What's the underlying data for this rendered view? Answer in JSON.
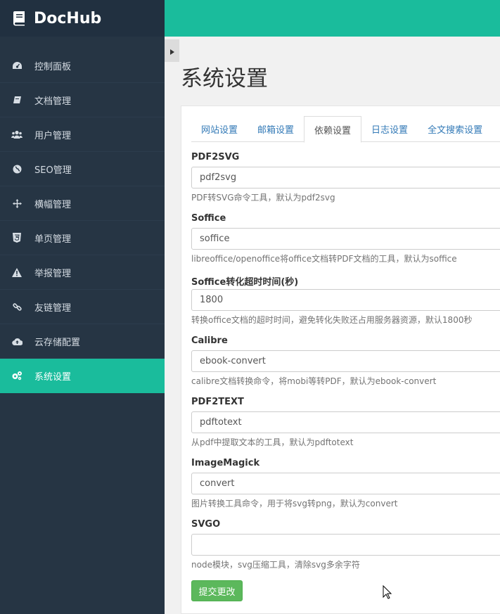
{
  "brand": {
    "name": "DocHub",
    "logo_icon": "book-icon"
  },
  "sidebar": {
    "items": [
      {
        "label": "控制面板",
        "icon": "dashboard-icon",
        "active": false
      },
      {
        "label": "文档管理",
        "icon": "book-icon",
        "active": false
      },
      {
        "label": "用户管理",
        "icon": "users-icon",
        "active": false
      },
      {
        "label": "SEO管理",
        "icon": "globe-icon",
        "active": false
      },
      {
        "label": "横幅管理",
        "icon": "arrows-icon",
        "active": false
      },
      {
        "label": "单页管理",
        "icon": "html5-icon",
        "active": false
      },
      {
        "label": "举报管理",
        "icon": "warning-icon",
        "active": false
      },
      {
        "label": "友链管理",
        "icon": "link-icon",
        "active": false
      },
      {
        "label": "云存储配置",
        "icon": "cloud-upload-icon",
        "active": false
      },
      {
        "label": "系统设置",
        "icon": "gears-icon",
        "active": true
      }
    ]
  },
  "page": {
    "title": "系统设置"
  },
  "tabs": [
    {
      "label": "网站设置",
      "active": false
    },
    {
      "label": "邮箱设置",
      "active": false
    },
    {
      "label": "依赖设置",
      "active": true
    },
    {
      "label": "日志设置",
      "active": false
    },
    {
      "label": "全文搜索设置",
      "active": false
    }
  ],
  "form": {
    "fields": [
      {
        "label": "PDF2SVG",
        "value": "pdf2svg",
        "help": "PDF转SVG命令工具，默认为pdf2svg"
      },
      {
        "label": "Soffice",
        "value": "soffice",
        "help": "libreoffice/openoffice将office文档转PDF文档的工具，默认为soffice"
      },
      {
        "label": "Soffice转化超时时间(秒)",
        "value": "1800",
        "help": "转换office文档的超时时间，避免转化失败还占用服务器资源，默认1800秒"
      },
      {
        "label": "Calibre",
        "value": "ebook-convert",
        "help": "calibre文档转换命令，将mobi等转PDF，默认为ebook-convert"
      },
      {
        "label": "PDF2TEXT",
        "value": "pdftotext",
        "help": "从pdf中提取文本的工具，默认为pdftotext"
      },
      {
        "label": "ImageMagick",
        "value": "convert",
        "help": "图片转换工具命令，用于将svg转png，默认为convert"
      },
      {
        "label": "SVGO",
        "value": "",
        "help": "node模块，svg压缩工具，清除svg多余字符"
      }
    ],
    "submit_label": "提交更改"
  },
  "colors": {
    "accent": "#1abc9c",
    "sidebar_bg": "#263544",
    "submit": "#5cb85c",
    "link": "#337ab7"
  }
}
